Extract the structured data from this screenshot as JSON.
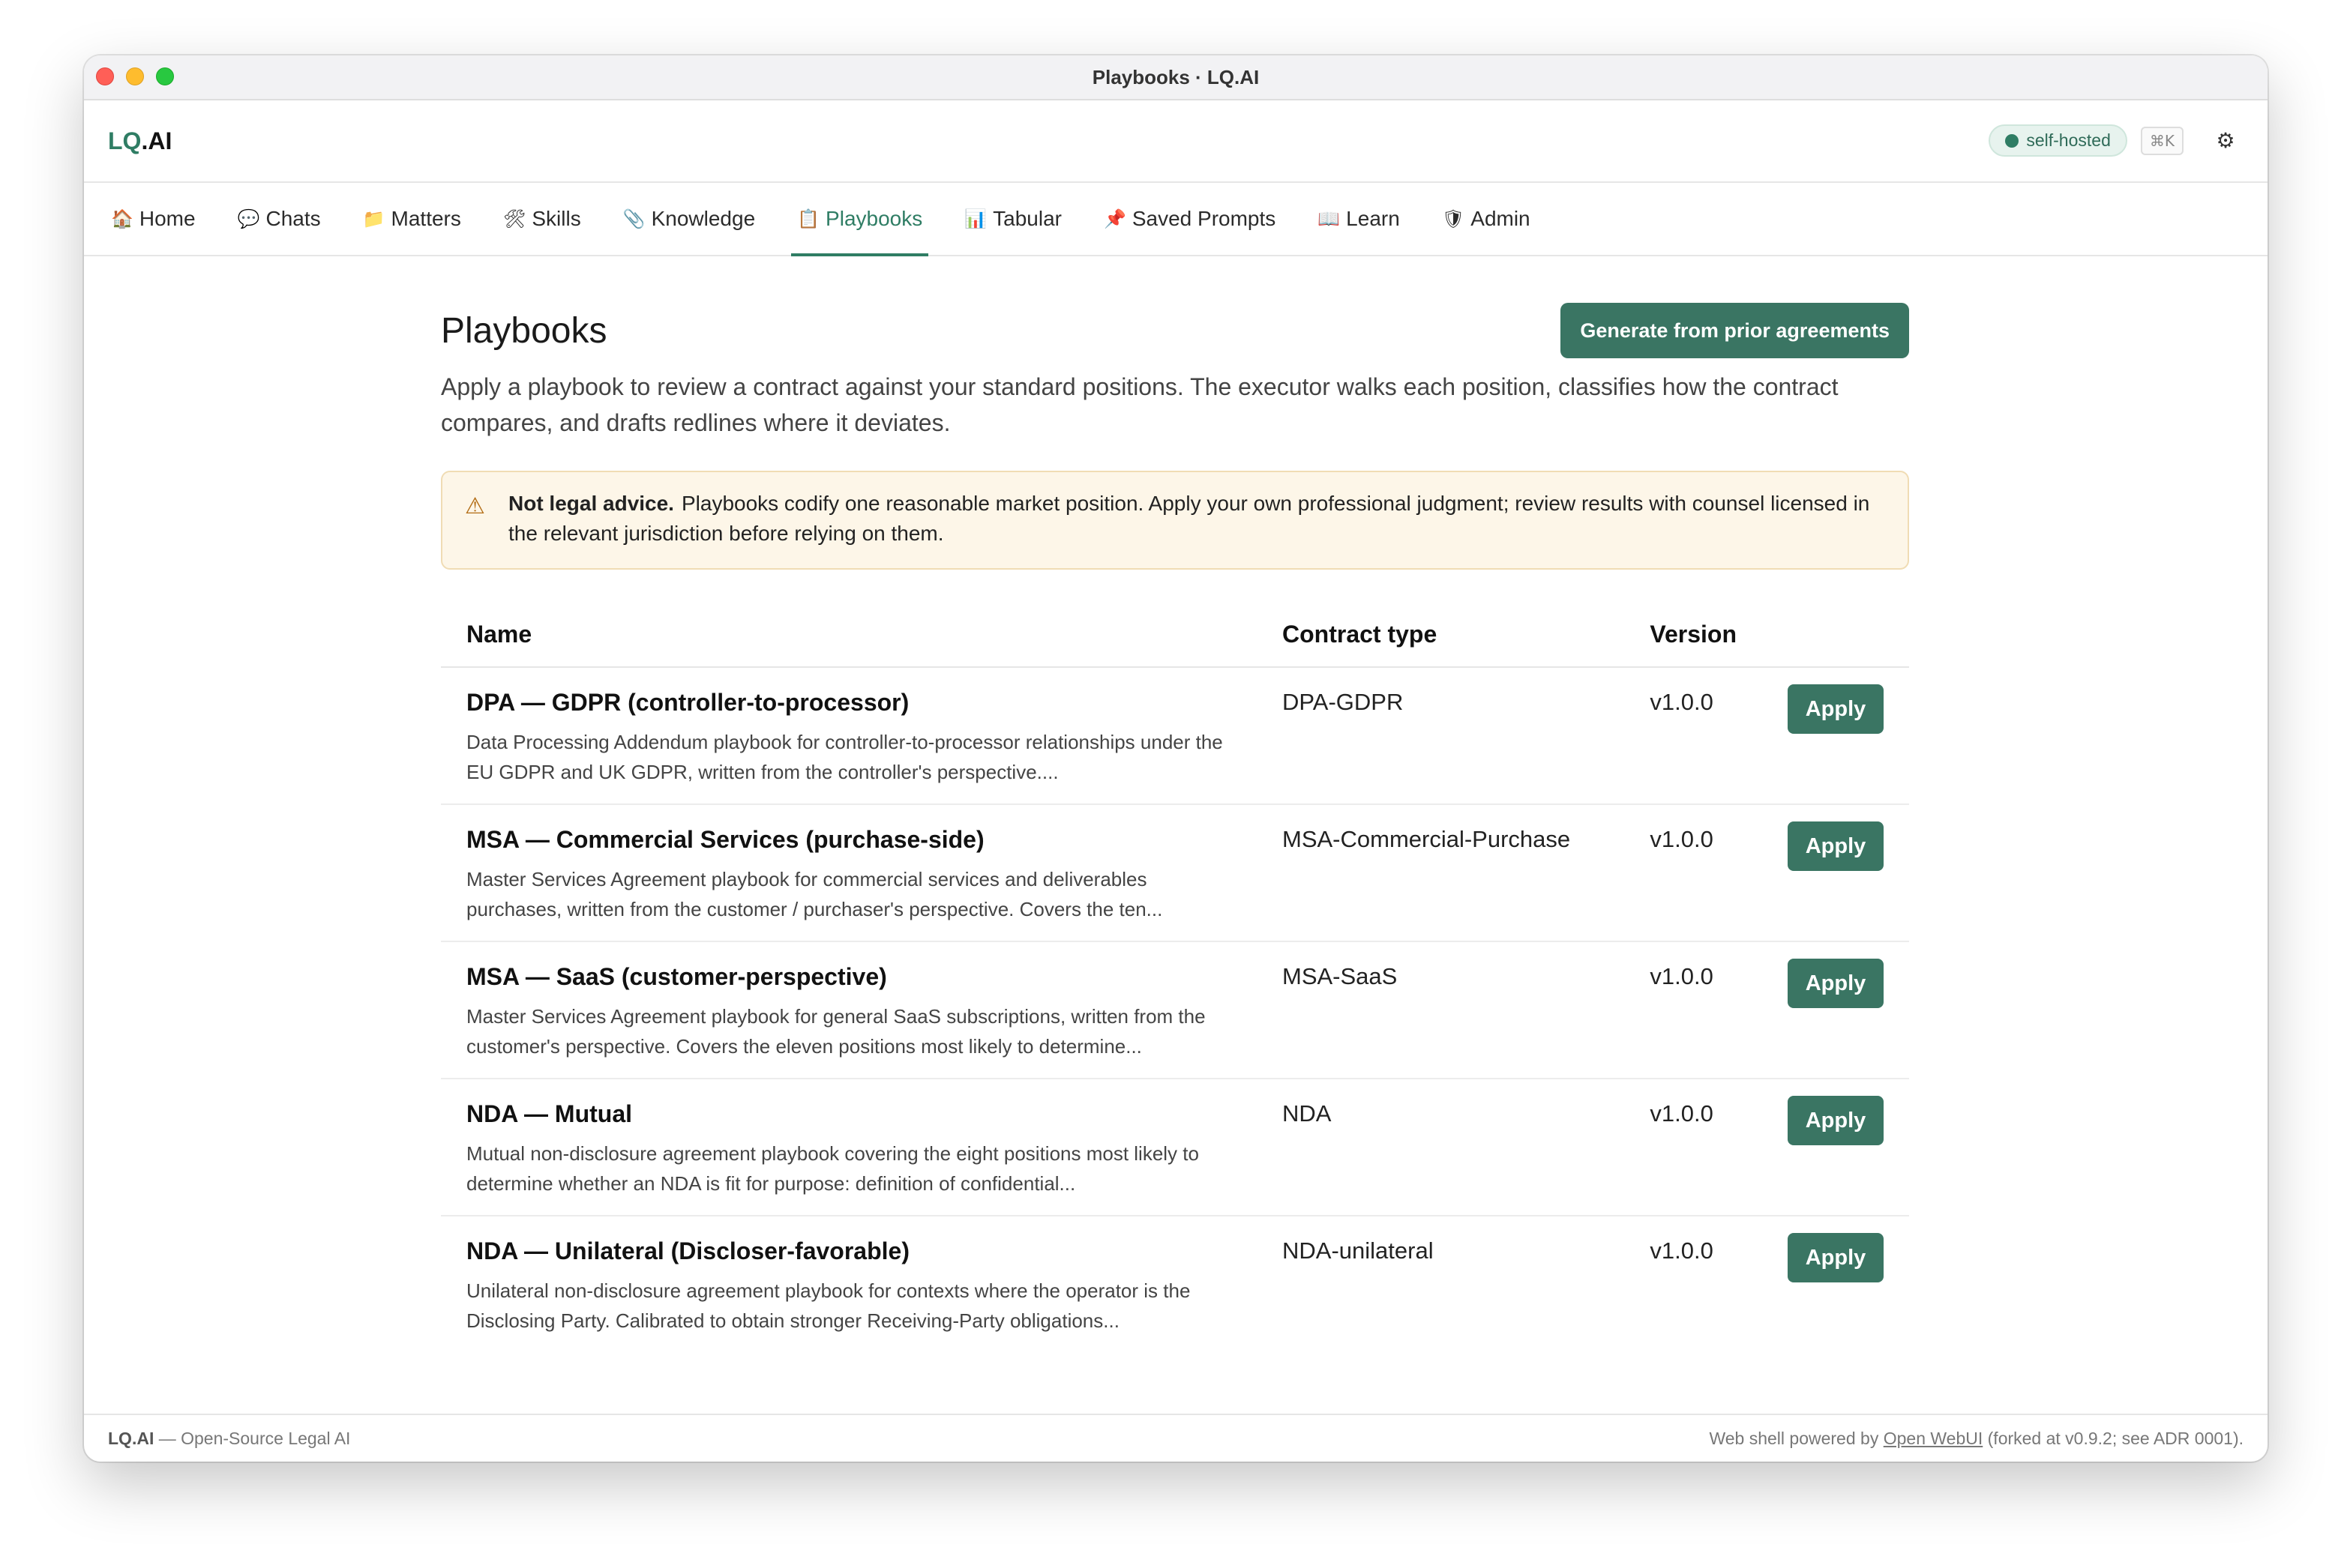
{
  "window": {
    "title": "Playbooks · LQ.AI"
  },
  "header": {
    "logo_lq": "LQ",
    "logo_rest": ".AI",
    "status_pill": "self-hosted",
    "shortcut": "⌘K",
    "settings_icon": "gear-icon"
  },
  "nav": {
    "items": [
      {
        "label": "Home",
        "icon": "🏠"
      },
      {
        "label": "Chats",
        "icon": "💬"
      },
      {
        "label": "Matters",
        "icon": "📁"
      },
      {
        "label": "Skills",
        "icon": "🛠"
      },
      {
        "label": "Knowledge",
        "icon": "📎"
      },
      {
        "label": "Playbooks",
        "icon": "📋"
      },
      {
        "label": "Tabular",
        "icon": "📊"
      },
      {
        "label": "Saved Prompts",
        "icon": "📌"
      },
      {
        "label": "Learn",
        "icon": "📖"
      },
      {
        "label": "Admin",
        "icon": "🛡"
      }
    ],
    "active": "Playbooks"
  },
  "page": {
    "title": "Playbooks",
    "generate_button": "Generate from prior agreements",
    "intro": "Apply a playbook to review a contract against your standard positions. The executor walks each position, classifies how the contract compares, and drafts redlines where it deviates.",
    "warning_title": "Not legal advice.",
    "warning_text": "Playbooks codify one reasonable market position. Apply your own professional judgment; review results with counsel licensed in the relevant jurisdiction before relying on them."
  },
  "table": {
    "headers": {
      "name": "Name",
      "type": "Contract type",
      "version": "Version"
    },
    "apply_label": "Apply",
    "rows": [
      {
        "name": "DPA — GDPR (controller-to-processor)",
        "desc": "Data Processing Addendum playbook for controller-to-processor relationships under the EU GDPR and UK GDPR, written from the controller's perspective....",
        "type": "DPA-GDPR",
        "version": "v1.0.0"
      },
      {
        "name": "MSA — Commercial Services (purchase-side)",
        "desc": "Master Services Agreement playbook for commercial services and deliverables purchases, written from the customer / purchaser's perspective. Covers the ten...",
        "type": "MSA-Commercial-Purchase",
        "version": "v1.0.0"
      },
      {
        "name": "MSA — SaaS (customer-perspective)",
        "desc": "Master Services Agreement playbook for general SaaS subscriptions, written from the customer's perspective. Covers the eleven positions most likely to determine...",
        "type": "MSA-SaaS",
        "version": "v1.0.0"
      },
      {
        "name": "NDA — Mutual",
        "desc": "Mutual non-disclosure agreement playbook covering the eight positions most likely to determine whether an NDA is fit for purpose: definition of confidential...",
        "type": "NDA",
        "version": "v1.0.0"
      },
      {
        "name": "NDA — Unilateral (Discloser-favorable)",
        "desc": "Unilateral non-disclosure agreement playbook for contexts where the operator is the Disclosing Party. Calibrated to obtain stronger Receiving-Party obligations...",
        "type": "NDA-unilateral",
        "version": "v1.0.0"
      }
    ]
  },
  "footer": {
    "brand": "LQ.AI",
    "tagline": " — Open-Source Legal AI",
    "powered_prefix": "Web shell powered by ",
    "powered_link": "Open WebUI",
    "powered_suffix": " (forked at v0.9.2; see ADR 0001)."
  },
  "colors": {
    "accent": "#3a7563",
    "warning_bg": "#fdf6e8"
  }
}
